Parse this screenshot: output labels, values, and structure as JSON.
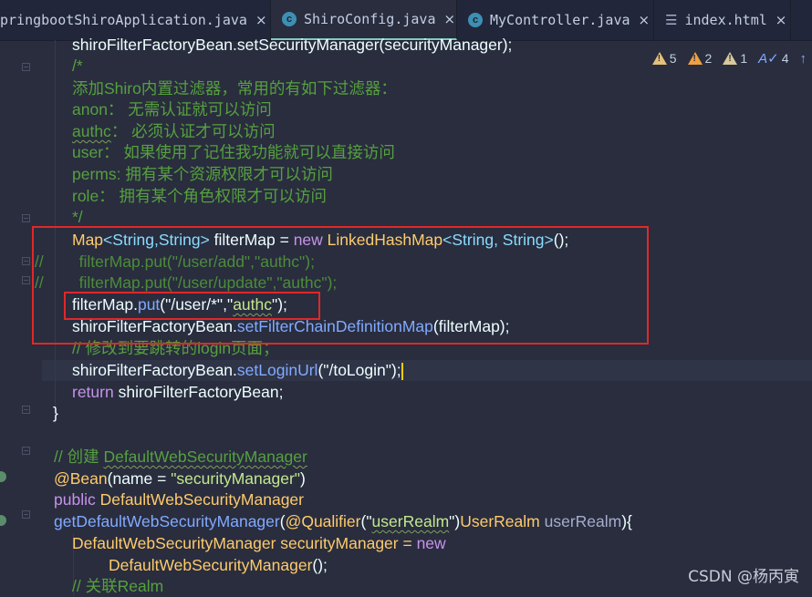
{
  "tabs": [
    {
      "label": "pringbootShiroApplication.java",
      "icon": "java-class-icon",
      "active": false
    },
    {
      "label": "ShiroConfig.java",
      "icon": "java-class-icon",
      "active": true
    },
    {
      "label": "MyController.java",
      "icon": "java-class-icon",
      "active": false
    },
    {
      "label": "index.html",
      "icon": "html-file-icon",
      "active": false
    }
  ],
  "tab_close_glyph": "×",
  "java_icon_letter": "c",
  "inspections": {
    "warnings": "5",
    "weak_warnings": "2",
    "info": "1",
    "typos": "4"
  },
  "code": {
    "l1": "shiroFilterFactoryBean.setSecurityManager(securityManager);",
    "l2": "/*",
    "l3": "添加Shiro内置过滤器，常用的有如下过滤器：",
    "l4": "anon： 无需认证就可以访问",
    "l5_word": "authc",
    "l5_rest": "： 必须认证才可以访问",
    "l6": "user： 如果使用了记住我功能就可以直接访问",
    "l7": "perms: 拥有某个资源权限才可以访问",
    "l8": "role： 拥有某个角色权限才可以访问",
    "l9": "*/",
    "l10_map": "Map",
    "l10_generic": "<String,String>",
    "l10_var": " filterMap = ",
    "l10_new": "new",
    "l10_cls": " LinkedHashMap",
    "l10_generic2": "<String, String>",
    "l10_end": "();",
    "l11_slash": "//",
    "l11": "        filterMap.put(\"/user/add\",\"authc\");",
    "l12_slash": "//",
    "l12": "        filterMap.put(\"/user/update\",\"authc\");",
    "l13_obj": "filterMap.",
    "l13_m": "put",
    "l13_a": "(\"/user/*\",\"",
    "l13_w": "authc",
    "l13_b": "\");",
    "l14_obj": "shiroFilterFactoryBean.",
    "l14_m": "setFilterChainDefinitionMap",
    "l14_a": "(filterMap);",
    "l15": "// 修改到要跳转的login页面；",
    "l16_obj": "shiroFilterFactoryBean.",
    "l16_m": "setLoginUrl",
    "l16_a": "(\"/toLogin\");",
    "l17_k": "return",
    "l17_a": " shiroFilterFactoryBean;",
    "l18": "}",
    "l19_c": "// 创建 ",
    "l19_w": "DefaultWebSecurityManager",
    "l20_at": "@Bean",
    "l20_a": "(name = ",
    "l20_s": "\"securityManager\"",
    "l20_b": ")",
    "l21_k": "public",
    "l21_a": " DefaultWebSecurityManager",
    "l22_m": "getDefaultWebSecurityManager",
    "l22_a": "(",
    "l22_at": "@Qualifier",
    "l22_b": "(\"",
    "l22_w": "userRealm",
    "l22_c": "\")",
    "l22_d": "UserRealm ",
    "l22_e": "userRealm",
    "l22_f": "){",
    "l23_a": "DefaultWebSecurityManager securityManager = ",
    "l23_k": "new",
    "l24_a": "DefaultWebSecurityManager",
    "l24_b": "();",
    "l25": "// 关联Realm"
  },
  "watermark": "CSDN @杨丙寅"
}
